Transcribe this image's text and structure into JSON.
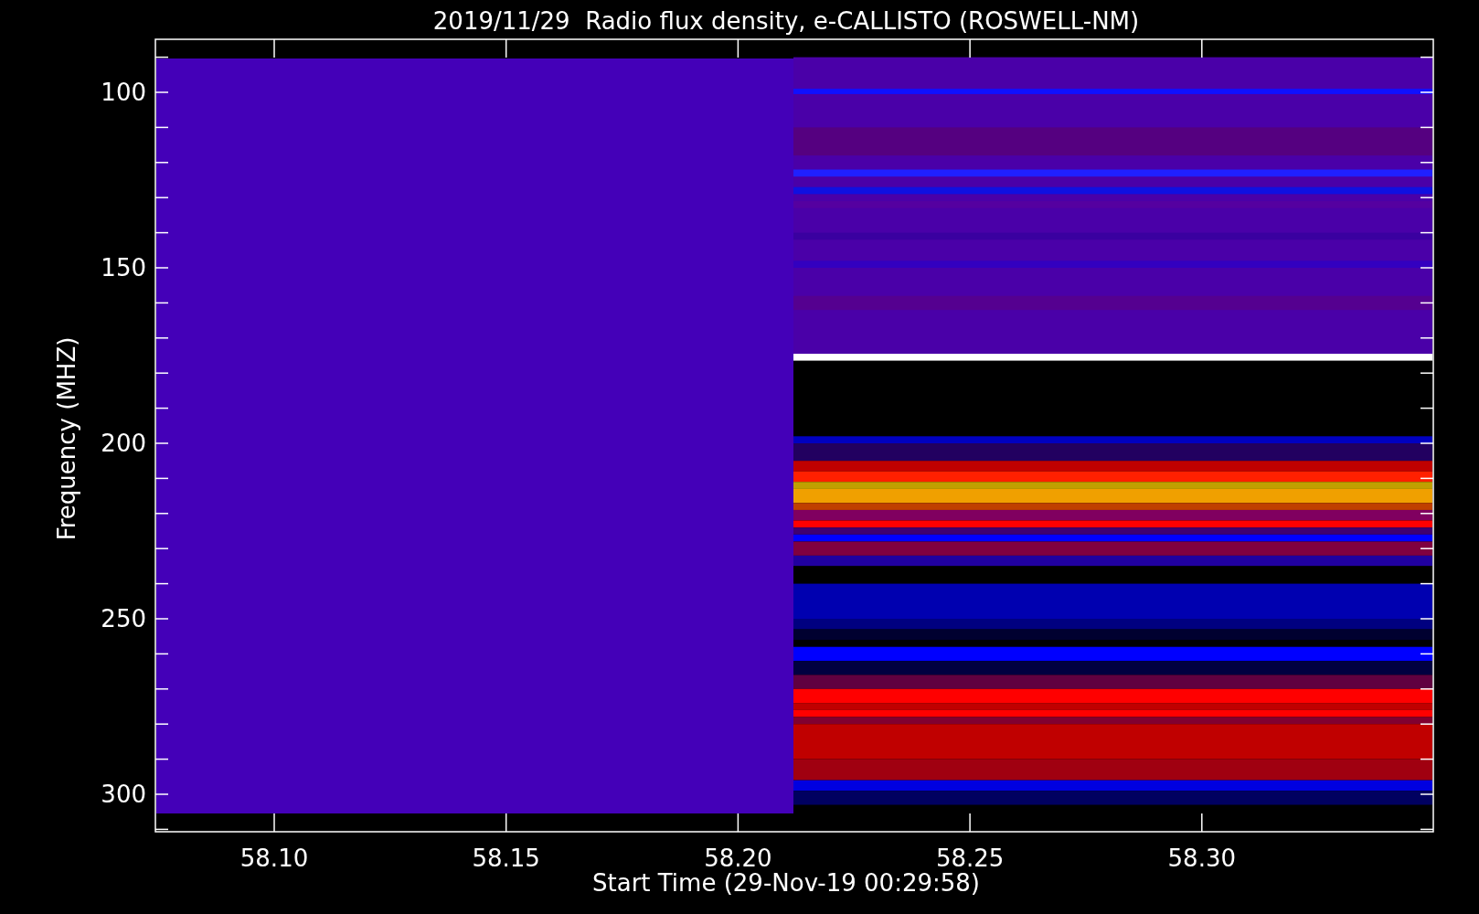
{
  "title": "2019/11/29  Radio flux density, e-CALLISTO (ROSWELL-NM)",
  "y_axis": {
    "label": "Frequency (MHZ)",
    "ticks": [
      "100",
      "150",
      "200",
      "250",
      "300"
    ]
  },
  "x_axis": {
    "label": "Start Time (29-Nov-19 00:29:58)",
    "ticks": [
      "58.10",
      "58.15",
      "58.20",
      "58.25",
      "58.30"
    ]
  }
}
